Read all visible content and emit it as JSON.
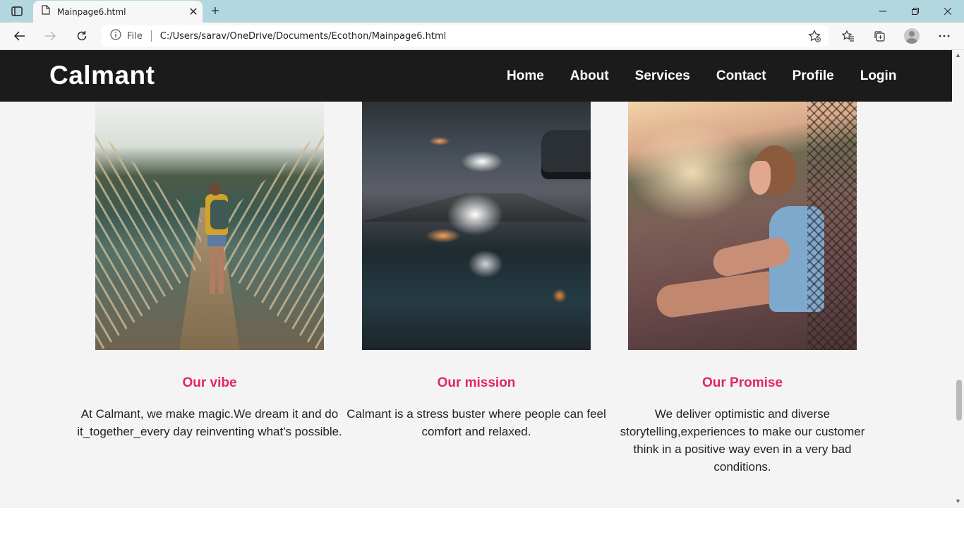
{
  "browser": {
    "tab_title": "Mainpage6.html",
    "address_scheme_label": "File",
    "address_url": "C:/Users/sarav/OneDrive/Documents/Ecothon/Mainpage6.html"
  },
  "site": {
    "logo": "Calmant",
    "nav": [
      "Home",
      "About",
      "Services",
      "Contact",
      "Profile",
      "Login"
    ]
  },
  "cards": [
    {
      "title": "Our vibe",
      "text": "At Calmant, we make magic.We dream it and do it_together_every day reinventing what's possible."
    },
    {
      "title": "Our mission",
      "text": "Calmant is a stress buster where people can feel comfort and relaxed."
    },
    {
      "title": "Our Promise",
      "text": "We deliver optimistic and diverse storytelling,experiences to make our customer think in a positive way even in a very bad conditions."
    }
  ],
  "colors": {
    "accent": "#e3246a",
    "nav_background": "#1b1b1b",
    "page_background": "#f4f4f4",
    "tabbar_background": "#b3d7e1"
  }
}
